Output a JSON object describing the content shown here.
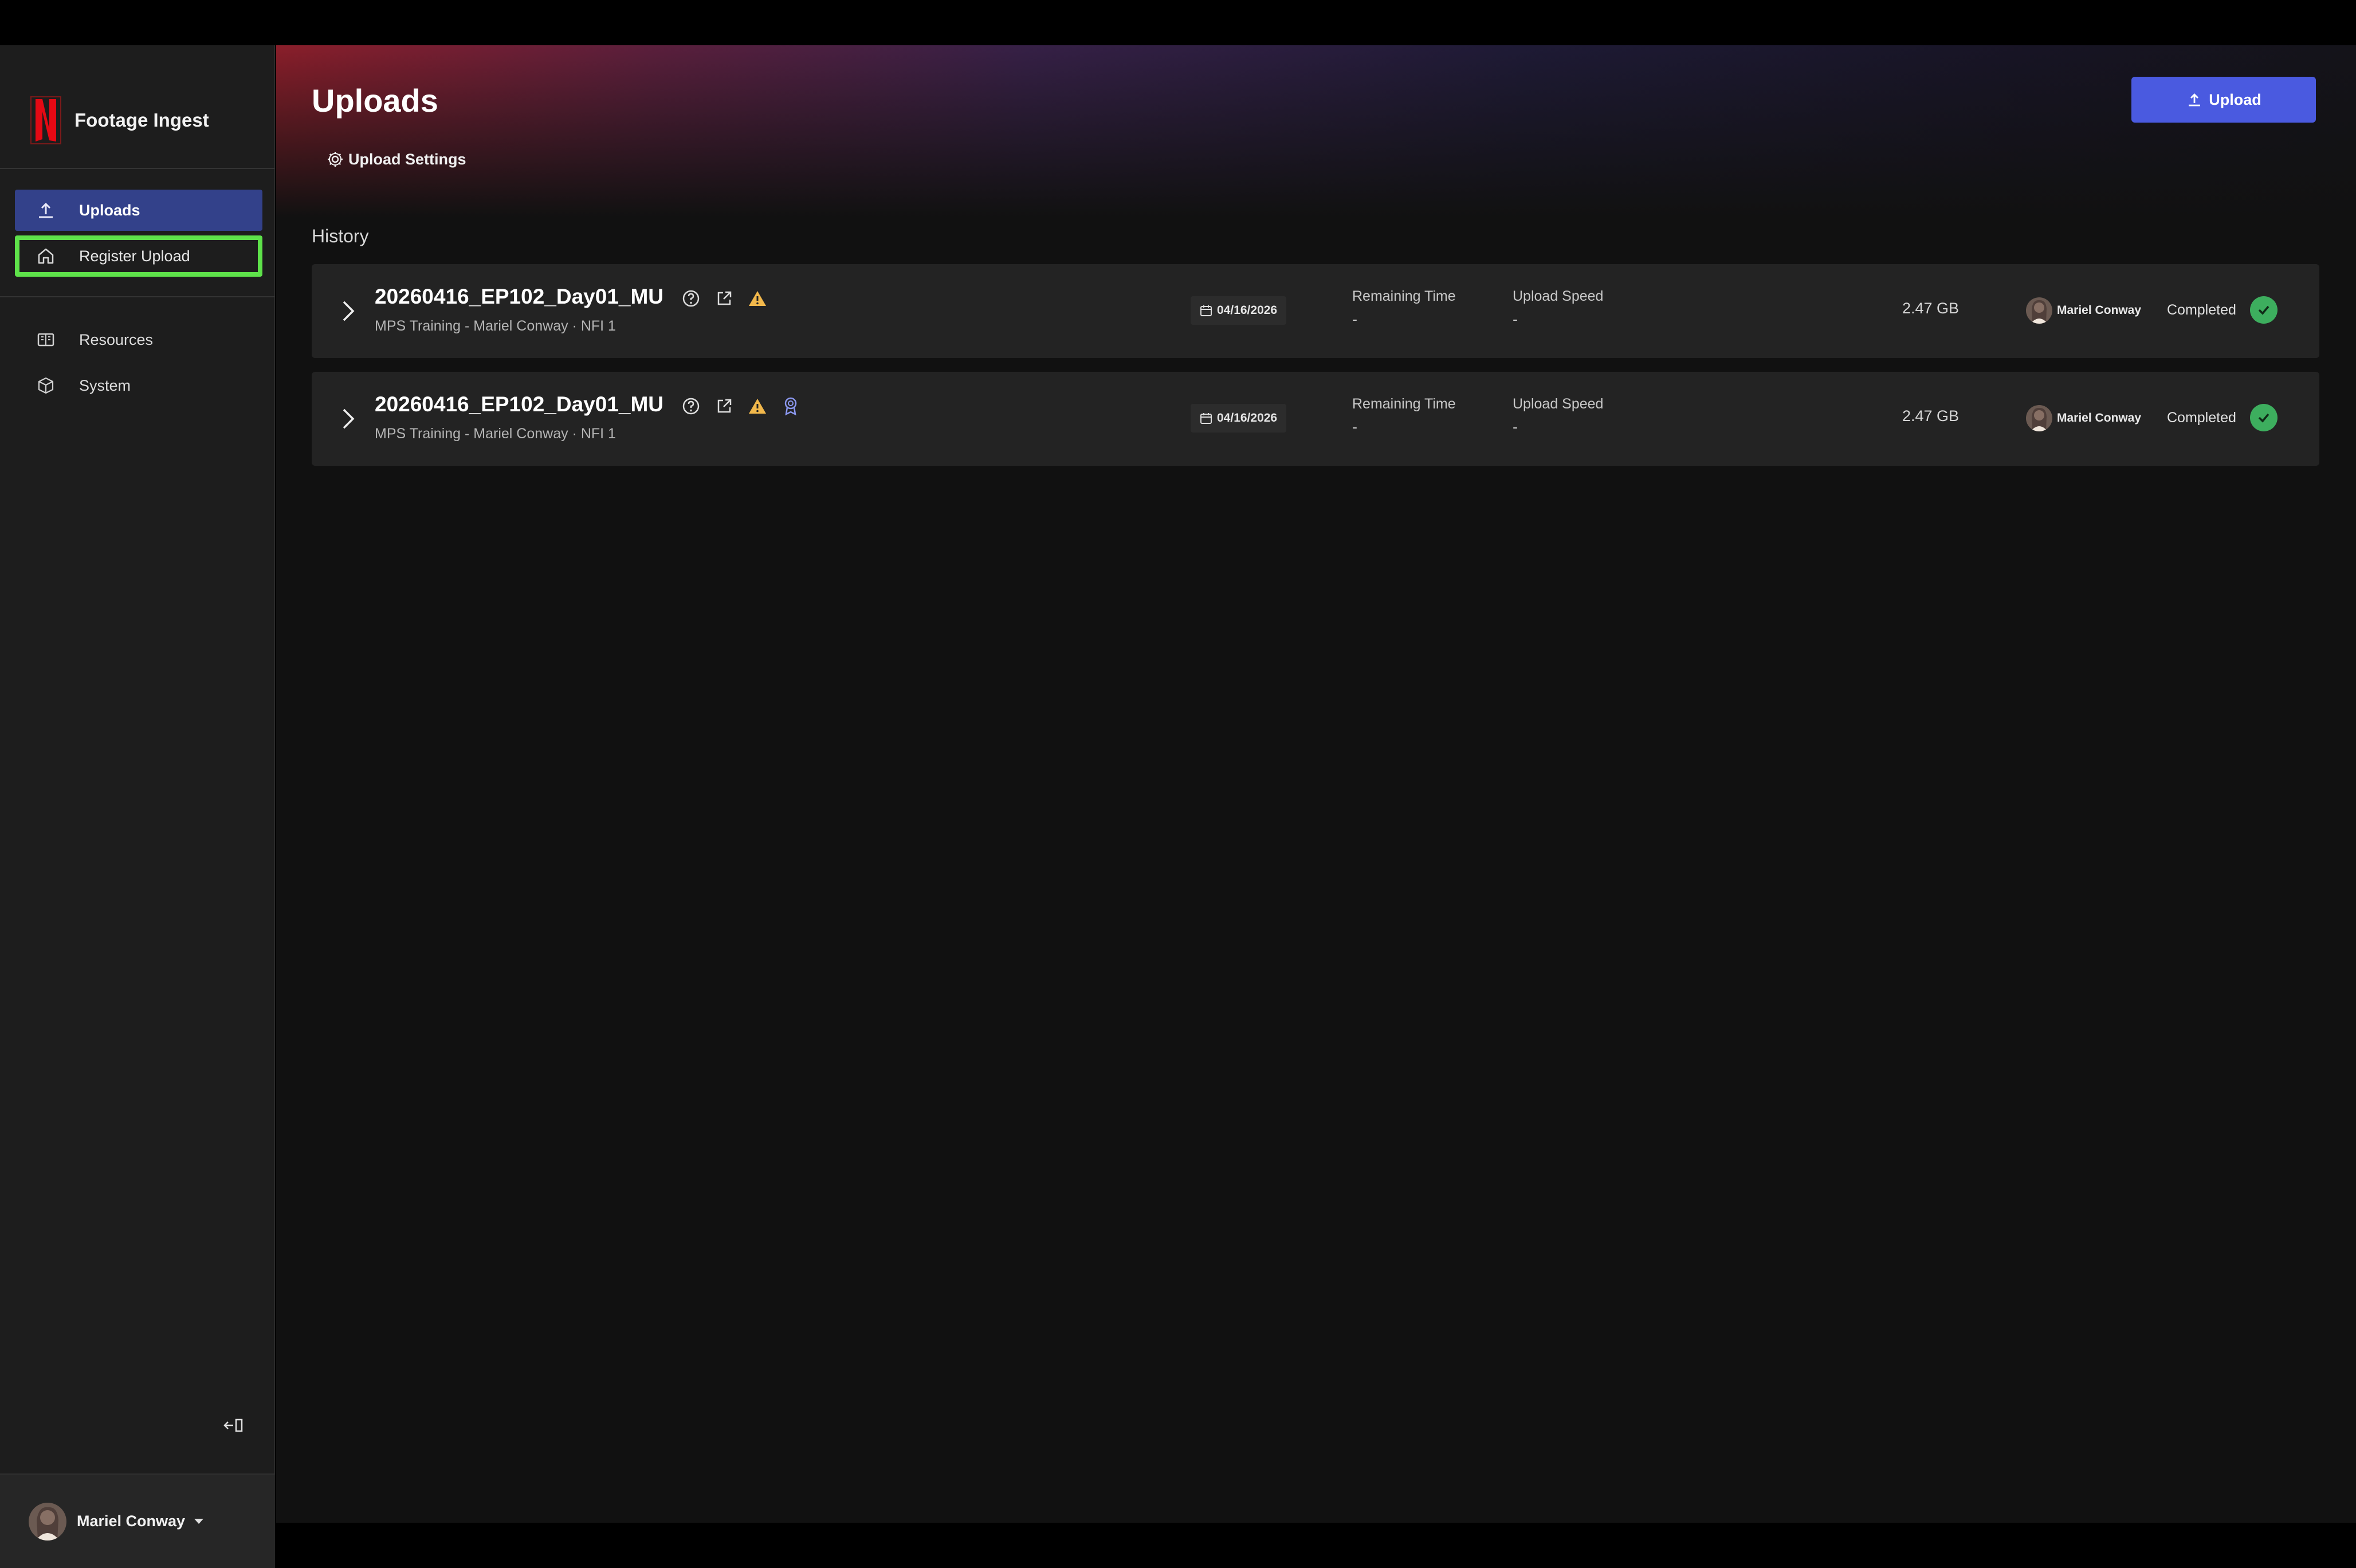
{
  "app": {
    "name": "Footage Ingest",
    "brand_color": "#e50914"
  },
  "sidebar": {
    "nav_primary": [
      {
        "label": "Uploads",
        "icon": "upload-icon",
        "active": true
      },
      {
        "label": "Register Upload",
        "icon": "home-icon",
        "active": false
      }
    ],
    "nav_secondary": [
      {
        "label": "Resources",
        "icon": "book-icon"
      },
      {
        "label": "System",
        "icon": "cube-icon"
      }
    ],
    "collapse_icon": "collapse-sidebar-icon",
    "user": {
      "name": "Mariel Conway"
    }
  },
  "header": {
    "title": "Uploads",
    "upload_button": "Upload",
    "settings_link": "Upload Settings"
  },
  "history": {
    "label": "History",
    "columns": {
      "remaining_time": "Remaining Time",
      "upload_speed": "Upload Speed"
    },
    "rows": [
      {
        "title": "20260416_EP102_Day01_MU",
        "subtitle": "MPS Training - Mariel Conway · NFI 1",
        "date": "04/16/2026",
        "remaining_time": "-",
        "upload_speed": "-",
        "size": "2.47 GB",
        "user": "Mariel Conway",
        "status": "Completed",
        "icons": [
          "help-icon",
          "external-link-icon",
          "warning-icon"
        ]
      },
      {
        "title": "20260416_EP102_Day01_MU",
        "subtitle": "MPS Training - Mariel Conway · NFI 1",
        "date": "04/16/2026",
        "remaining_time": "-",
        "upload_speed": "-",
        "size": "2.47 GB",
        "user": "Mariel Conway",
        "status": "Completed",
        "icons": [
          "help-icon",
          "external-link-icon",
          "warning-icon",
          "badge-icon"
        ]
      }
    ]
  },
  "colors": {
    "accent": "#4a5ae0",
    "active_nav": "#33418a",
    "highlight": "#5ee24a",
    "success": "#3dae5e",
    "warning": "#f2b84b"
  }
}
